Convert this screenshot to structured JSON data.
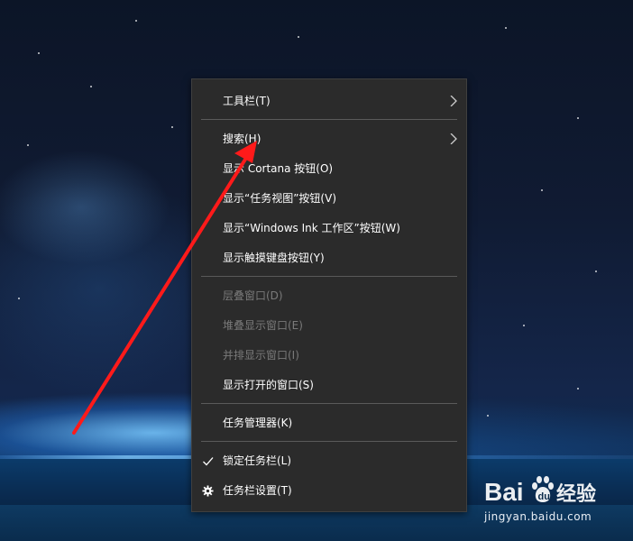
{
  "context_menu": {
    "items": [
      {
        "label": "工具栏(T)",
        "enabled": true,
        "submenu": true
      },
      {
        "label": "搜索(H)",
        "enabled": true,
        "submenu": true
      },
      {
        "label": "显示 Cortana 按钮(O)",
        "enabled": true
      },
      {
        "label": "显示“任务视图”按钮(V)",
        "enabled": true
      },
      {
        "label": "显示“Windows Ink 工作区”按钮(W)",
        "enabled": true
      },
      {
        "label": "显示触摸键盘按钮(Y)",
        "enabled": true
      },
      {
        "label": "层叠窗口(D)",
        "enabled": false
      },
      {
        "label": "堆叠显示窗口(E)",
        "enabled": false
      },
      {
        "label": "并排显示窗口(I)",
        "enabled": false
      },
      {
        "label": "显示打开的窗口(S)",
        "enabled": true
      },
      {
        "label": "任务管理器(K)",
        "enabled": true
      },
      {
        "label": "锁定任务栏(L)",
        "enabled": true,
        "checked": true,
        "icon": "checkmark-icon"
      },
      {
        "label": "任务栏设置(T)",
        "enabled": true,
        "icon": "gear-icon"
      }
    ]
  },
  "annotation": {
    "type": "red-arrow",
    "color": "#ff1a1a",
    "points_to": "搜索(H)"
  },
  "watermark": {
    "brand": "Baidu经验",
    "url": "jingyan.baidu.com"
  },
  "colors": {
    "menu_bg": "#2b2b2b",
    "menu_text": "#ffffff",
    "menu_disabled": "#7a7a7a",
    "separator": "#5a5a5a"
  }
}
